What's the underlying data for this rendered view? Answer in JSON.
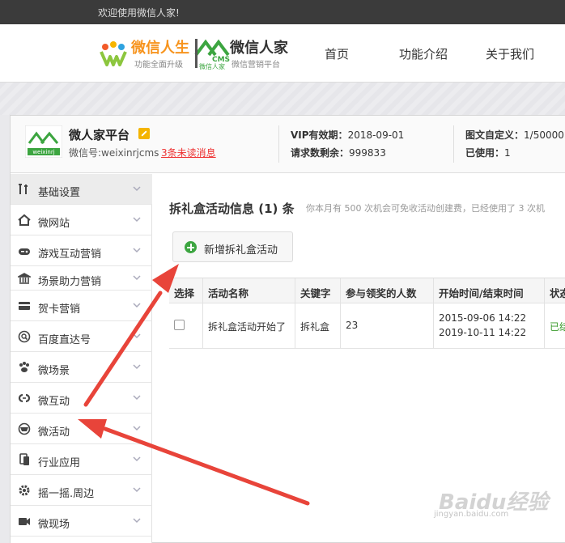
{
  "topbar": {
    "welcome": "欢迎使用微信人家!"
  },
  "header": {
    "logo1": {
      "brand": "微信人生",
      "slogan": "功能全面升级"
    },
    "logo2": {
      "brand": "微信人家",
      "cms": "CMS",
      "sub": "微信人家",
      "slogan": "微信营销平台"
    },
    "nav": [
      {
        "label": "首页"
      },
      {
        "label": "功能介绍"
      },
      {
        "label": "关于我们"
      }
    ]
  },
  "account": {
    "logo_text": "weixinrj",
    "name": "微人家平台",
    "wechat_id": "微信号:weixinrjcms",
    "unread": "3条未读消息",
    "vip_label": "VIP有效期：",
    "vip_value": "2018-09-01",
    "requests_label": "请求数剩余：",
    "requests_value": "999833",
    "custom_label": "图文自定义：",
    "custom_value": "1/50000",
    "used_label": "已使用：",
    "used_value": "1"
  },
  "sidebar": {
    "items": [
      {
        "label": "基础设置",
        "icon": "tools-icon",
        "active": true
      },
      {
        "label": "微网站",
        "icon": "home-icon"
      },
      {
        "label": "游戏互动营销",
        "icon": "gamepad-icon"
      },
      {
        "label": "场景助力营销",
        "icon": "bank-icon"
      },
      {
        "label": "贺卡营销",
        "icon": "card-icon"
      },
      {
        "label": "百度直达号",
        "icon": "search-circle-icon"
      },
      {
        "label": "微场景",
        "icon": "paw-icon"
      },
      {
        "label": "微互动",
        "icon": "link-icon"
      },
      {
        "label": "微活动",
        "icon": "target-icon"
      },
      {
        "label": "行业应用",
        "icon": "phone-icon"
      },
      {
        "label": "摇一摇.周边",
        "icon": "gear-icon"
      },
      {
        "label": "微现场",
        "icon": "camera-icon"
      }
    ]
  },
  "content": {
    "title": "拆礼盒活动信息 (1) 条",
    "note": "你本月有 500 次机会可免收活动创建费，已经使用了 3 次机",
    "add_button": "新增拆礼盒活动",
    "table": {
      "headers": [
        "选择",
        "活动名称",
        "关键字",
        "参与领奖的人数",
        "开始时间/结束时间",
        "状态"
      ],
      "rows": [
        {
          "name": "拆礼盒活动开始了",
          "keyword": "拆礼盒",
          "participants": "23",
          "start": "2015-09-06 14:22",
          "end": "2019-10-11 14:22",
          "status": "已结"
        }
      ]
    }
  },
  "watermark": {
    "text": "Baidu经验",
    "sub": "jingyan.baidu.com"
  },
  "colors": {
    "accent_orange": "#f7941e",
    "green": "#3ca540",
    "arrow_red": "#e8443a",
    "unread_red": "#ee3333"
  }
}
